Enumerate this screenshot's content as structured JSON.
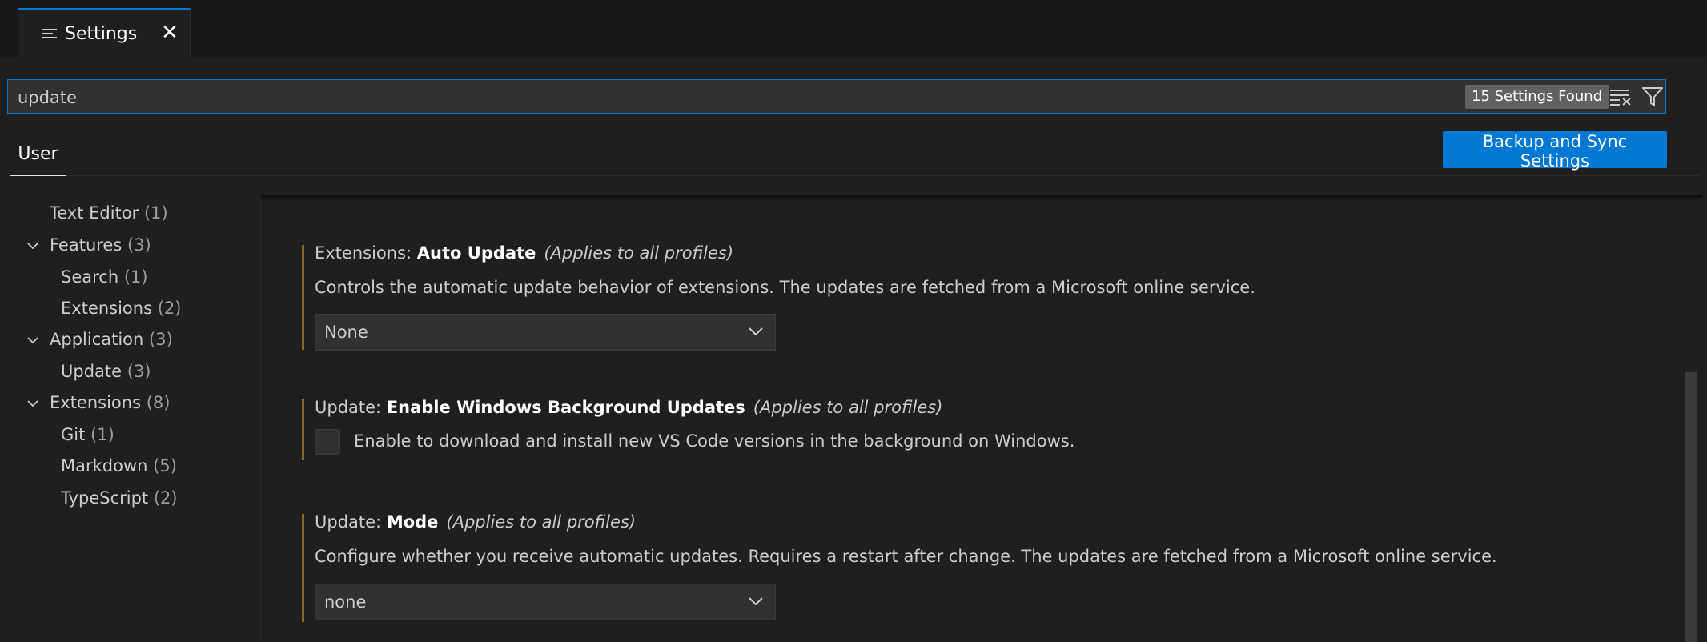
{
  "tab": {
    "label": "Settings",
    "close": "✕"
  },
  "search": {
    "value": "update",
    "found": "15 Settings Found"
  },
  "scope": {
    "user_label": "User",
    "sync_button": "Backup and Sync Settings"
  },
  "toc": [
    {
      "label": "Text Editor",
      "count": "(1)"
    },
    {
      "label": "Features",
      "count": "(3)"
    },
    {
      "label": "Search",
      "count": "(1)"
    },
    {
      "label": "Extensions",
      "count": "(2)"
    },
    {
      "label": "Application",
      "count": "(3)"
    },
    {
      "label": "Update",
      "count": "(3)"
    },
    {
      "label": "Extensions",
      "count": "(8)"
    },
    {
      "label": "Git",
      "count": "(1)"
    },
    {
      "label": "Markdown",
      "count": "(5)"
    },
    {
      "label": "TypeScript",
      "count": "(2)"
    }
  ],
  "settings": [
    {
      "category": "Extensions: ",
      "name": "Auto Update",
      "scope": "(Applies to all profiles)",
      "description": "Controls the automatic update behavior of extensions. The updates are fetched from a Microsoft online service.",
      "value": "None"
    },
    {
      "category": "Update: ",
      "name": "Enable Windows Background Updates",
      "scope": "(Applies to all profiles)",
      "description": "Enable to download and install new VS Code versions in the background on Windows."
    },
    {
      "category": "Update: ",
      "name": "Mode",
      "scope": "(Applies to all profiles)",
      "description": "Configure whether you receive automatic updates. Requires a restart after change. The updates are fetched from a Microsoft online service.",
      "value": "none"
    }
  ]
}
